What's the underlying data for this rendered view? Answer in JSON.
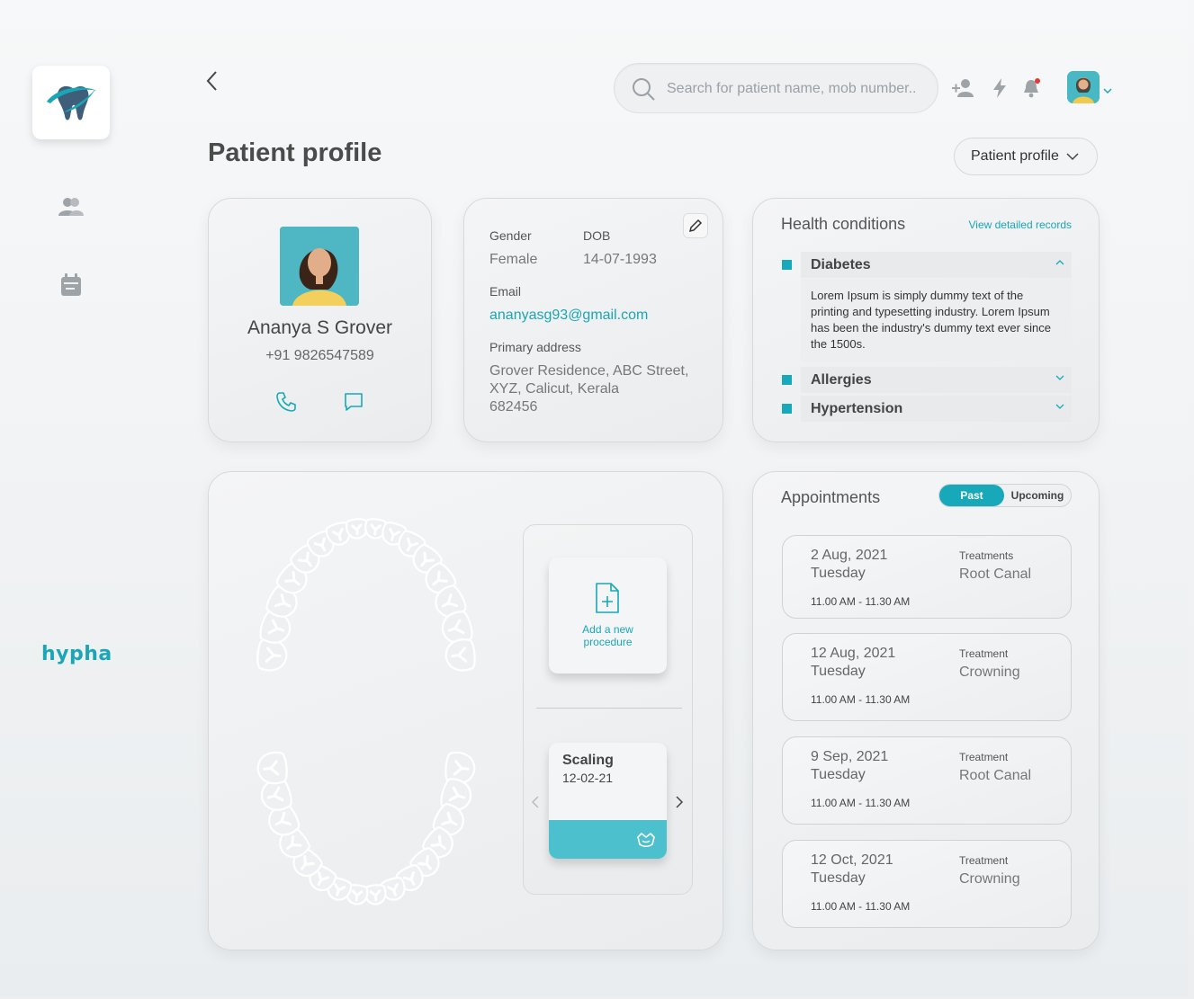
{
  "header": {
    "search_placeholder": "Search for patient name, mob number..",
    "page_title": "Patient profile",
    "view_select": "Patient profile"
  },
  "sidebar": {
    "brand": "hypha",
    "items": [
      {
        "name": "patients",
        "icon": "users-icon"
      },
      {
        "name": "calendar",
        "icon": "calendar-icon"
      }
    ]
  },
  "patient": {
    "name": "Ananya S Grover",
    "phone": "+91 9826547589",
    "gender_label": "Gender",
    "gender": "Female",
    "dob_label": "DOB",
    "dob": "14-07-1993",
    "email_label": "Email",
    "email": "ananyasg93@gmail.com",
    "address_label": "Primary address",
    "address_line1": "Grover Residence, ABC Street,",
    "address_line2": "XYZ, Calicut, Kerala",
    "address_line3": "682456"
  },
  "health": {
    "title": "Health conditions",
    "link": "View detailed records",
    "conditions": [
      {
        "name": "Diabetes",
        "expanded": true,
        "description": "Lorem Ipsum is simply dummy text of the printing and typesetting industry. Lorem Ipsum has been the industry's dummy text ever since the 1500s."
      },
      {
        "name": "Allergies",
        "expanded": false
      },
      {
        "name": "Hypertension",
        "expanded": false
      }
    ]
  },
  "procedures": {
    "add_label": "Add a new procedure",
    "current": {
      "name": "Scaling",
      "date": "12-02-21"
    }
  },
  "appointments": {
    "title": "Appointments",
    "tab_past": "Past",
    "tab_upcoming": "Upcoming",
    "items": [
      {
        "date": "2 Aug, 2021",
        "day": "Tuesday",
        "time": "11.00 AM - 11.30 AM",
        "label": "Treatments",
        "treatment": "Root Canal"
      },
      {
        "date": "12 Aug, 2021",
        "day": "Tuesday",
        "time": "11.00 AM - 11.30 AM",
        "label": "Treatment",
        "treatment": "Crowning"
      },
      {
        "date": "9 Sep, 2021",
        "day": "Tuesday",
        "time": "11.00 AM - 11.30 AM",
        "label": "Treatment",
        "treatment": "Root Canal"
      },
      {
        "date": "12 Oct, 2021",
        "day": "Tuesday",
        "time": "11.00 AM - 11.30 AM",
        "label": "Treatment",
        "treatment": "Crowning"
      }
    ]
  },
  "colors": {
    "accent": "#17a9b9",
    "brand": "#1aa6b7",
    "notification": "#e53935"
  }
}
